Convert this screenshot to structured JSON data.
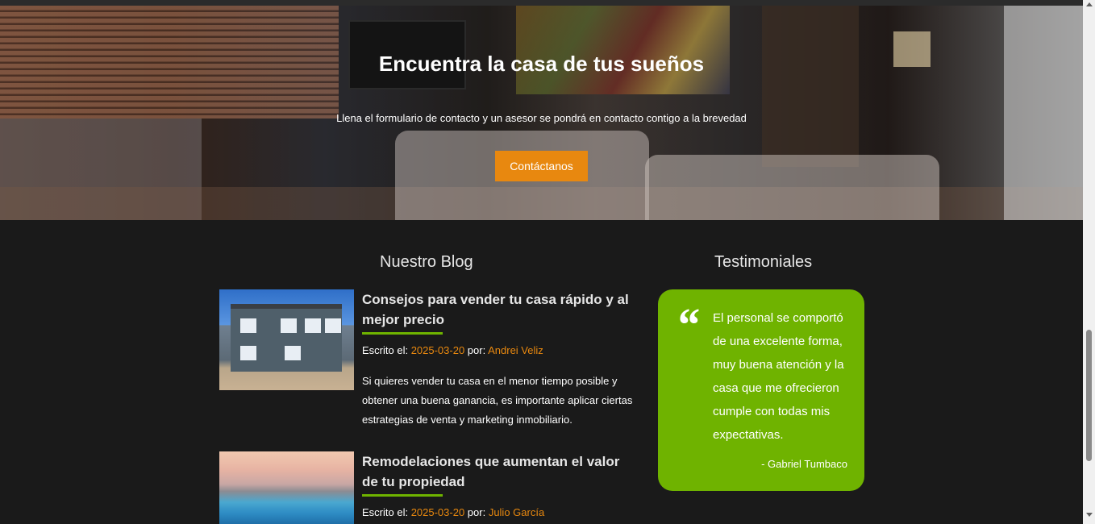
{
  "hero": {
    "title": "Encuentra la casa de tus sueños",
    "subtitle": "Llena el formulario de contacto y un asesor se pondrá en contacto contigo a la brevedad",
    "button_label": "Contáctanos"
  },
  "blog": {
    "section_title": "Nuestro Blog",
    "posts": [
      {
        "title": "Consejos para vender tu casa rápido y al mejor precio",
        "meta_prefix": "Escrito el: ",
        "date": "2025-03-20",
        "by_label": " por: ",
        "author": "Andrei Veliz",
        "excerpt": "Si quieres vender tu casa en el menor tiempo posible y obtener una buena ganancia, es importante aplicar ciertas estrategias de venta y marketing inmobiliario."
      },
      {
        "title": "Remodelaciones que aumentan el valor de tu propiedad",
        "meta_prefix": "Escrito el: ",
        "date": "2025-03-20",
        "by_label": " por: ",
        "author": "Julio García"
      }
    ]
  },
  "testimonials": {
    "section_title": "Testimoniales",
    "quote_mark": "“",
    "quote": "El personal se comportó de una excelente forma, muy buena atención y la casa que me ofrecieron cumple con todas mis expectativas.",
    "author": "- Gabriel Tumbaco"
  },
  "colors": {
    "accent_orange": "#e8880f",
    "accent_green": "#6fb300",
    "background": "#1a1a1a"
  }
}
